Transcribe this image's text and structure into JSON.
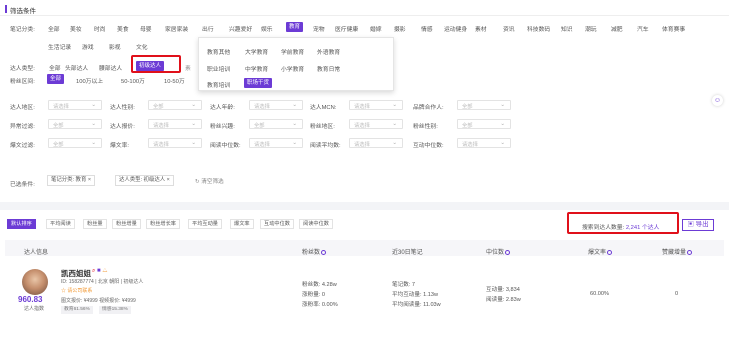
{
  "filter_title": "筛选条件",
  "note_category": {
    "label": "笔记分类:",
    "row1": [
      "全部",
      "美妆",
      "时尚",
      "美食",
      "母婴",
      "家居家装",
      "出行",
      "兴趣爱好",
      "娱乐",
      "教育",
      "宠物",
      "医疗健康",
      "婚嫁",
      "摄影",
      "情感",
      "运动健身",
      "素材",
      "资讯",
      "科技数码",
      "知识",
      "潮玩",
      "减肥",
      "汽车",
      "体育赛事"
    ],
    "row2": [
      "生活记录",
      "游戏",
      "影视",
      "文化"
    ],
    "active": "教育"
  },
  "talent_type": {
    "label": "达人类型:",
    "options": [
      "全部",
      "头部达人",
      "腰部达人",
      "初级达人"
    ],
    "active": "初级达人",
    "overlap": "素"
  },
  "fans_range": {
    "label": "粉丝区间:",
    "options": [
      "全部",
      "100万以上",
      "50-100万",
      "10-50万"
    ]
  },
  "dropdown": {
    "rows": [
      [
        "教育其他",
        "大学教育",
        "学前教育",
        "外语教育"
      ],
      [
        "职业培训",
        "中学教育",
        "小学教育",
        "教育日常"
      ],
      [
        "教育培训",
        "职场干货"
      ]
    ],
    "active": "职场干货"
  },
  "selects": {
    "row1": [
      {
        "label": "达人地区:",
        "placeholder": "请选择"
      },
      {
        "label": "达人性别:",
        "placeholder": "全部"
      },
      {
        "label": "达人年龄:",
        "placeholder": "请选择"
      },
      {
        "label": "达人MCN:",
        "placeholder": "请选择"
      },
      {
        "label": "品牌合作人:",
        "placeholder": "全部"
      }
    ],
    "row2": [
      {
        "label": "异常过滤:",
        "placeholder": "全部"
      },
      {
        "label": "达人报价:",
        "placeholder": "请选择"
      },
      {
        "label": "粉丝兴趣:",
        "placeholder": "全部"
      },
      {
        "label": "粉丝地区:",
        "placeholder": "请选择"
      },
      {
        "label": "粉丝性别:",
        "placeholder": "全部"
      }
    ],
    "row3": [
      {
        "label": "爆文过滤:",
        "placeholder": "全部"
      },
      {
        "label": "爆文率:",
        "placeholder": "请选择"
      },
      {
        "label": "阅读中位数:",
        "placeholder": "请选择"
      },
      {
        "label": "阅读平均数:",
        "placeholder": "请选择"
      },
      {
        "label": "互动中位数:",
        "placeholder": "请选择"
      }
    ]
  },
  "selected": {
    "label": "已选条件:",
    "tags": [
      "笔记分类: 教育 ×",
      "达人类型: 初级达人 ×"
    ],
    "clear": "清空筛选"
  },
  "sort_tabs": [
    "默认排序",
    "平均阅读",
    "粉丝量",
    "粉丝增量",
    "粉丝增长率",
    "平均互动量",
    "爆文率",
    "互动中位数",
    "阅读中位数"
  ],
  "sort_active": "默认排序",
  "search_count_label": "搜索到达人数量:",
  "search_count": "2,241",
  "search_count_unit": "个达人",
  "export_label": "导出",
  "columns": [
    "达人信息",
    "粉丝数",
    "近30日笔记",
    "中位数",
    "爆文率",
    "赞藏增量"
  ],
  "row": {
    "name": "凯西姐姐",
    "id_line": "ID: 158287774 | 北京 朝阳 | 初级达人",
    "contact": "请公司联系",
    "price_line": "图文报价: ¥4999  视频报价: ¥4999",
    "score": "960.83",
    "score_label": "达人指数",
    "badges": [
      "教育61.56%",
      "情感15.38%"
    ],
    "fans": [
      "粉丝数: 4.28w",
      "涨粉量: 0",
      "涨粉率: 0.00%"
    ],
    "notes": [
      "笔记数: 7",
      "平均互动量: 1.13w",
      "平均阅读量: 11.03w"
    ],
    "medians": [
      "互动量: 3,834",
      "阅读量: 2.83w"
    ],
    "viral_rate": "60.00%",
    "likes_growth": "0"
  },
  "colors": {
    "accent": "#6c3bd5",
    "highlight": "#e0101a"
  }
}
